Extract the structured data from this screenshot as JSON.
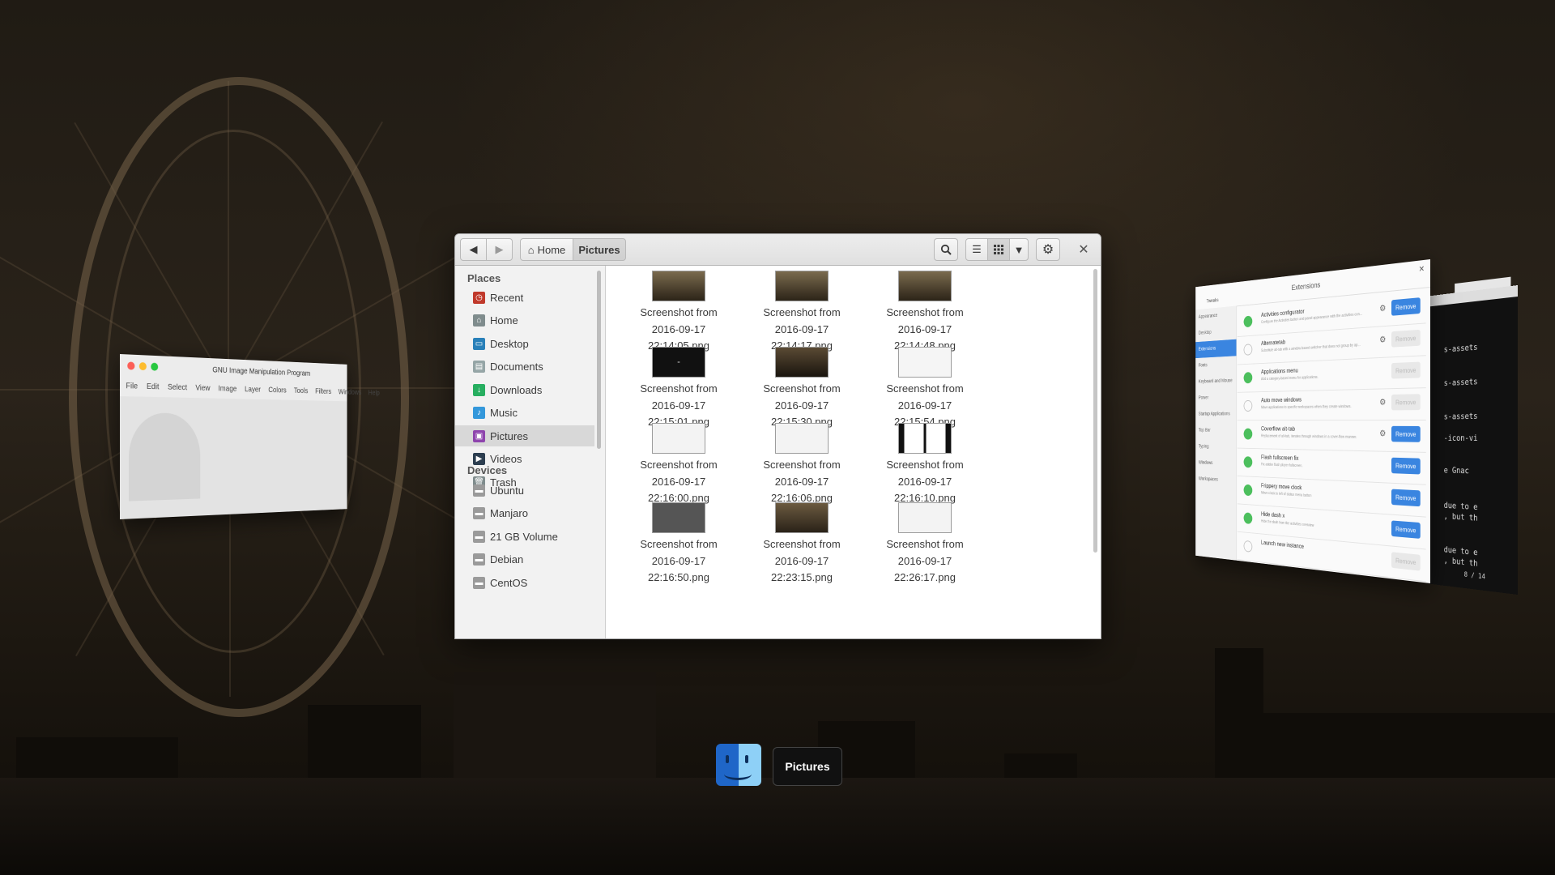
{
  "files_window": {
    "breadcrumb": {
      "home": "Home",
      "current": "Pictures"
    },
    "sidebar": {
      "places_heading": "Places",
      "places": [
        {
          "label": "Recent",
          "icon": "recent-icon"
        },
        {
          "label": "Home",
          "icon": "home-icon"
        },
        {
          "label": "Desktop",
          "icon": "desktop-icon"
        },
        {
          "label": "Documents",
          "icon": "documents-icon"
        },
        {
          "label": "Downloads",
          "icon": "downloads-icon"
        },
        {
          "label": "Music",
          "icon": "music-icon"
        },
        {
          "label": "Pictures",
          "icon": "pictures-icon",
          "active": true
        },
        {
          "label": "Videos",
          "icon": "videos-icon"
        },
        {
          "label": "Trash",
          "icon": "trash-icon"
        }
      ],
      "devices_heading": "Devices",
      "devices": [
        {
          "label": "Ubuntu",
          "icon": "drive-icon"
        },
        {
          "label": "Manjaro",
          "icon": "drive-icon"
        },
        {
          "label": "21 GB Volume",
          "icon": "drive-icon"
        },
        {
          "label": "Debian",
          "icon": "drive-icon"
        },
        {
          "label": "CentOS",
          "icon": "drive-icon"
        }
      ]
    },
    "files": [
      {
        "line1": "Screenshot from",
        "line2": "2016-09-17",
        "line3": "22:14:05.png"
      },
      {
        "line1": "Screenshot from",
        "line2": "2016-09-17",
        "line3": "22:14:17.png"
      },
      {
        "line1": "Screenshot from",
        "line2": "2016-09-17",
        "line3": "22:14:48.png"
      },
      {
        "line1": "Screenshot from",
        "line2": "2016-09-17",
        "line3": "22:15:01.png"
      },
      {
        "line1": "Screenshot from",
        "line2": "2016-09-17",
        "line3": "22:15:30.png"
      },
      {
        "line1": "Screenshot from",
        "line2": "2016-09-17",
        "line3": "22:15:54.png"
      },
      {
        "line1": "Screenshot from",
        "line2": "2016-09-17",
        "line3": "22:16:00.png"
      },
      {
        "line1": "Screenshot from",
        "line2": "2016-09-17",
        "line3": "22:16:06.png"
      },
      {
        "line1": "Screenshot from",
        "line2": "2016-09-17",
        "line3": "22:16:10.png"
      },
      {
        "line1": "Screenshot from",
        "line2": "2016-09-17",
        "line3": "22:16:50.png"
      },
      {
        "line1": "Screenshot from",
        "line2": "2016-09-17",
        "line3": "22:23:15.png"
      },
      {
        "line1": "Screenshot from",
        "line2": "2016-09-17",
        "line3": "22:26:17.png"
      }
    ]
  },
  "gimp_window": {
    "title": "GNU Image Manipulation Program",
    "menu": [
      "File",
      "Edit",
      "Select",
      "View",
      "Image",
      "Layer",
      "Colors",
      "Tools",
      "Filters",
      "Windows",
      "Help"
    ]
  },
  "tweaks_window": {
    "app": "Tweaks",
    "title": "Extensions",
    "sidebar": [
      "Appearance",
      "Desktop",
      "Extensions",
      "Fonts",
      "Keyboard and Mouse",
      "Power",
      "Startup Applications",
      "Top Bar",
      "Typing",
      "Windows",
      "Workspaces"
    ],
    "selected": "Extensions",
    "remove_label": "Remove",
    "extensions": [
      {
        "name": "Activities configurator",
        "desc": "Configure the Activities button and panel appearance with the activities con...",
        "on": true,
        "gear": true,
        "remove_enabled": true
      },
      {
        "name": "Alternatetab",
        "desc": "Substitute alt-tab with a window based switcher that does not group by ap...",
        "on": false,
        "gear": true,
        "remove_enabled": false
      },
      {
        "name": "Applications menu",
        "desc": "Add a category-based menu for applications.",
        "on": true,
        "gear": false,
        "remove_enabled": false
      },
      {
        "name": "Auto move windows",
        "desc": "Move applications to specific workspaces when they create windows.",
        "on": false,
        "gear": true,
        "remove_enabled": false
      },
      {
        "name": "Coverflow alt-tab",
        "desc": "Replacement of alt-tab, iterates through windows in a cover-flow manner.",
        "on": true,
        "gear": true,
        "remove_enabled": true
      },
      {
        "name": "Flash fullscreen fix",
        "desc": "Fix adobe flash player fullscreen.",
        "on": true,
        "gear": false,
        "remove_enabled": true
      },
      {
        "name": "Frippery move clock",
        "desc": "Move clock to left of status menu button",
        "on": true,
        "gear": false,
        "remove_enabled": true
      },
      {
        "name": "Hide dash x",
        "desc": "Hide the dash from the activities overview",
        "on": true,
        "gear": false,
        "remove_enabled": true
      },
      {
        "name": "Launch new instance",
        "desc": "",
        "on": false,
        "gear": false,
        "remove_enabled": false
      }
    ]
  },
  "terminal_window": {
    "lines": [
      "s-assets",
      "s-assets",
      "s-assets",
      "-icon-vi",
      "e Gnac",
      "due to e",
      ", but th",
      "due to e",
      ", but th"
    ],
    "footer": "8 / 14"
  },
  "switcher": {
    "label": "Pictures",
    "icon": "finder-icon"
  },
  "colors": {
    "accent_blue": "#3a85e0",
    "toggle_green": "#4cbf5d"
  }
}
